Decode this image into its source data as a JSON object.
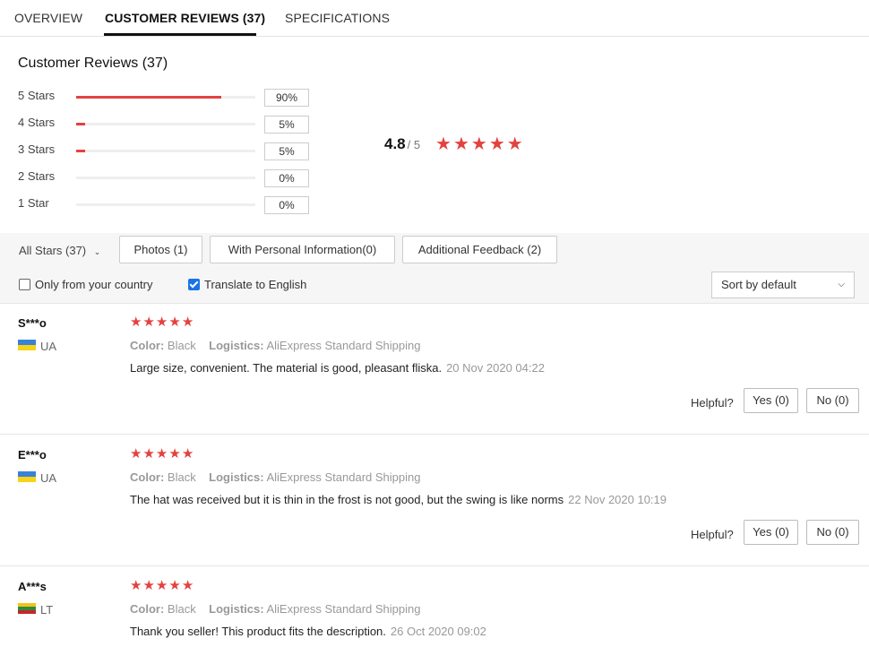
{
  "tabs": [
    "OVERVIEW",
    "CUSTOMER REVIEWS (37)",
    "SPECIFICATIONS"
  ],
  "summary": {
    "title": "Customer Reviews (37)",
    "distribution": [
      {
        "label": "5 Stars",
        "percent": "90%",
        "fraction": 0.9
      },
      {
        "label": "4 Stars",
        "percent": "5%",
        "fraction": 0.05
      },
      {
        "label": "3 Stars",
        "percent": "5%",
        "fraction": 0.05
      },
      {
        "label": "2 Stars",
        "percent": "0%",
        "fraction": 0
      },
      {
        "label": "1 Star",
        "percent": "0%",
        "fraction": 0
      }
    ],
    "average": "4.8",
    "out_of": "/ 5",
    "average_stars": 5
  },
  "filters": {
    "all_stars": "All Stars (37)",
    "buttons": [
      "Photos (1)",
      "With Personal Information(0)",
      "Additional Feedback (2)"
    ],
    "only_country": {
      "label": "Only from your country",
      "checked": false
    },
    "translate": {
      "label": "Translate to English",
      "checked": true
    },
    "sort": "Sort by default"
  },
  "reviews": [
    {
      "name": "S***o",
      "country": "UA",
      "stars": 5,
      "color_label": "Color:",
      "color": "Black",
      "logistics_label": "Logistics:",
      "logistics": "AliExpress Standard Shipping",
      "text": "Large size, convenient. The material is good, pleasant fliska.",
      "date": "20 Nov 2020 04:22",
      "helpful": "Helpful?",
      "yes": "Yes (0)",
      "no": "No (0)"
    },
    {
      "name": "E***o",
      "country": "UA",
      "stars": 5,
      "color_label": "Color:",
      "color": "Black",
      "logistics_label": "Logistics:",
      "logistics": "AliExpress Standard Shipping",
      "text": "The hat was received but it is thin in the frost is not good, but the swing is like norms",
      "date": "22 Nov 2020 10:19",
      "helpful": "Helpful?",
      "yes": "Yes (0)",
      "no": "No (0)"
    },
    {
      "name": "A***s",
      "country": "LT",
      "stars": 5,
      "color_label": "Color:",
      "color": "Black",
      "logistics_label": "Logistics:",
      "logistics": "AliExpress Standard Shipping",
      "text": "Thank you seller! This product fits the description.",
      "date": "26 Oct 2020 09:02"
    }
  ],
  "colors": {
    "accent": "#e3423f",
    "check": "#1a73e8",
    "ua_blue": "#3b82d6",
    "ua_yellow": "#f7d417",
    "lt_yellow": "#f3c316",
    "lt_green": "#2e8b3e",
    "lt_red": "#c0282d"
  }
}
